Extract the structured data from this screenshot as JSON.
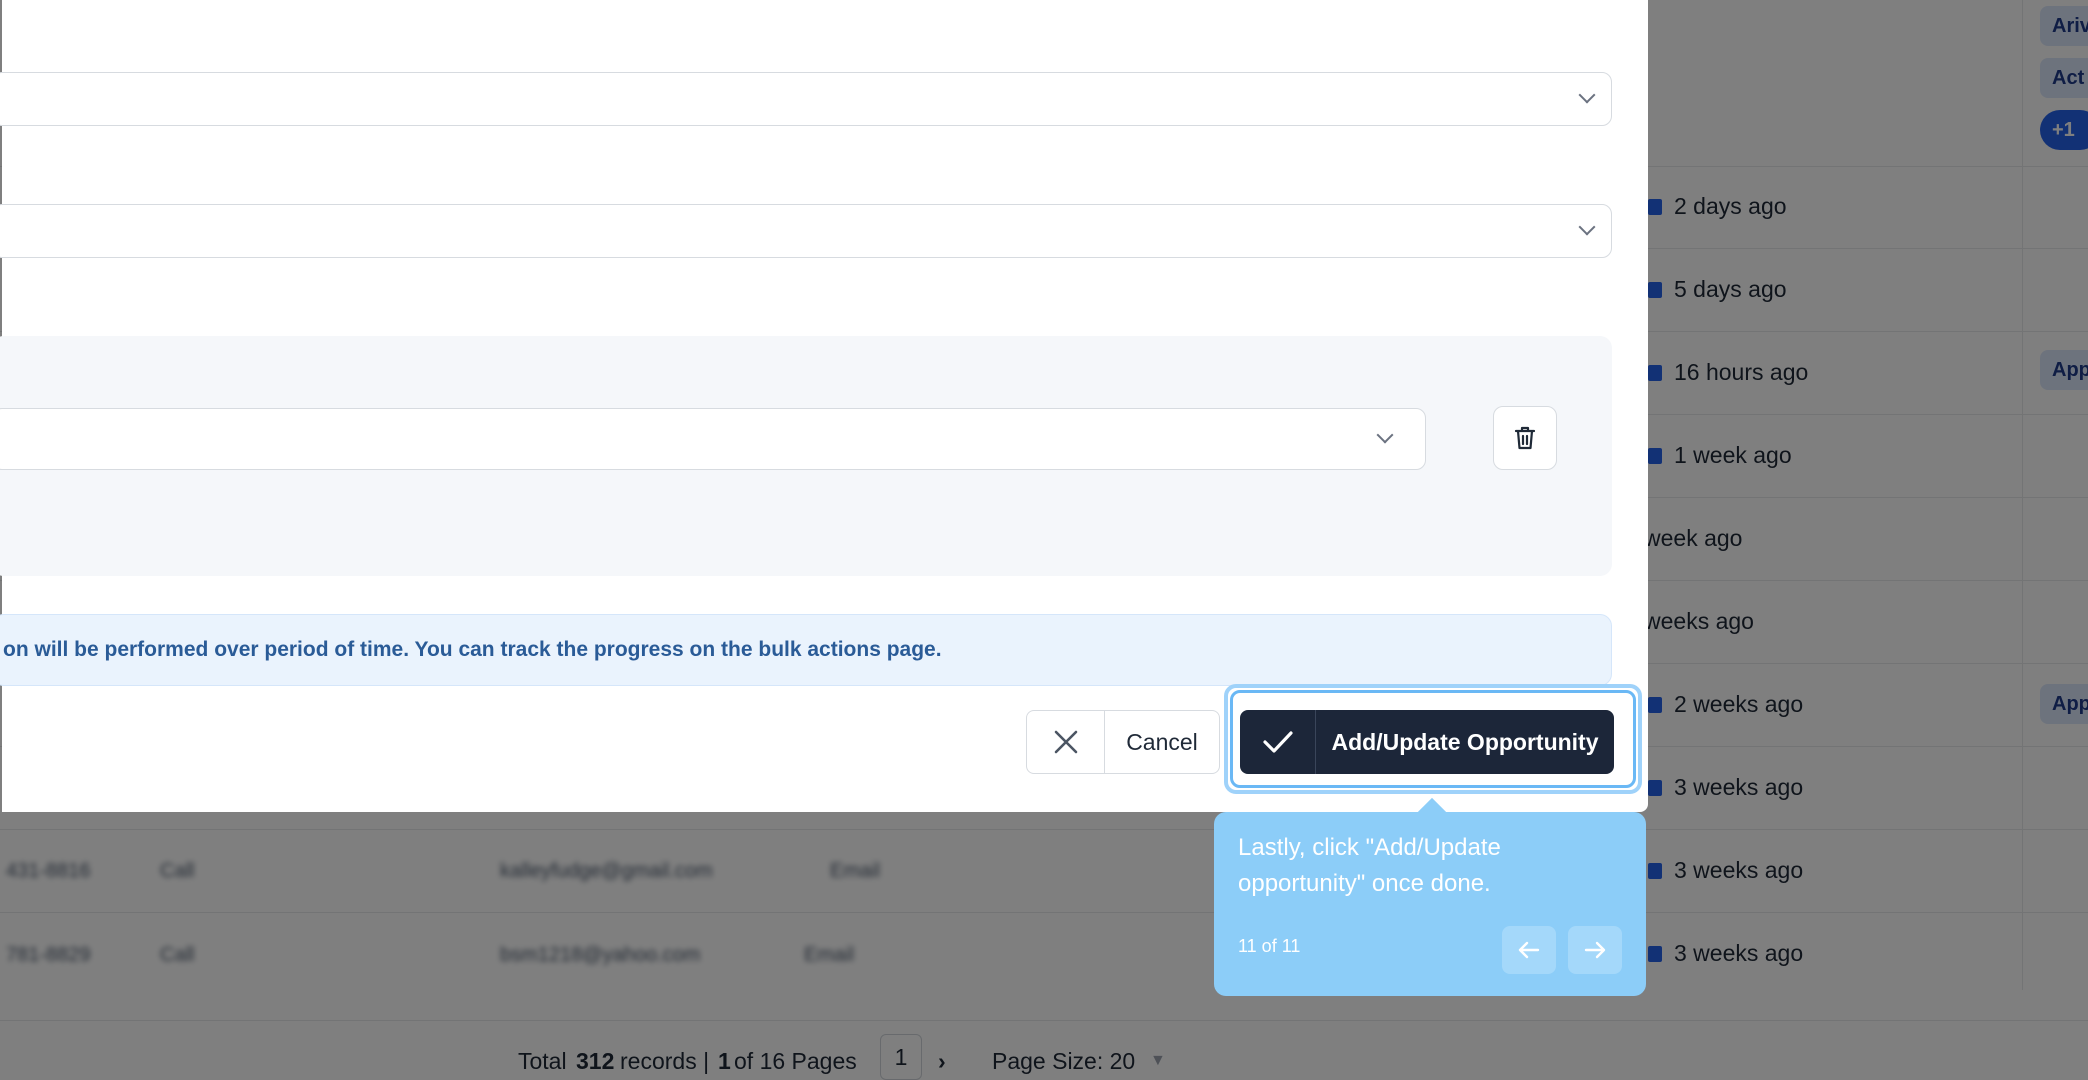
{
  "background": {
    "times": [
      "2 days ago",
      "5 days ago",
      "16 hours ago",
      "1 week ago",
      "week ago",
      "weeks ago",
      "2 weeks ago",
      "3 weeks ago",
      "3 weeks ago",
      "3 weeks ago"
    ],
    "tags": [
      "Ariv",
      "Act",
      "+1",
      "App",
      "App"
    ],
    "blurred_rows": [
      {
        "phone": "431-8816",
        "call": "Call",
        "email": "kalleyfudge@gmail.com",
        "email_label": "Email"
      },
      {
        "phone": "781-8829",
        "call": "Call",
        "email": "bsm1218@yahoo.com",
        "email_label": "Email"
      }
    ],
    "pagination": {
      "total_prefix": "Total",
      "total_count": "312",
      "total_suffix": "records |",
      "current": "1",
      "of_pages": "of 16 Pages",
      "page_input": "1",
      "page_size": "Page Size: 20"
    }
  },
  "modal": {
    "info_text": "on will be performed over period of time. You can track the progress on the bulk actions page.",
    "cancel_label": "Cancel",
    "submit_label": "Add/Update Opportunity"
  },
  "tooltip": {
    "message": "Lastly, click \"Add/Update opportunity\" once done.",
    "step": "11 of 11"
  },
  "colors": {
    "primary": "#1c2639",
    "highlight": "#6ab8f5",
    "tooltip": "#8ccdf8",
    "info_text": "#2a5b97"
  }
}
